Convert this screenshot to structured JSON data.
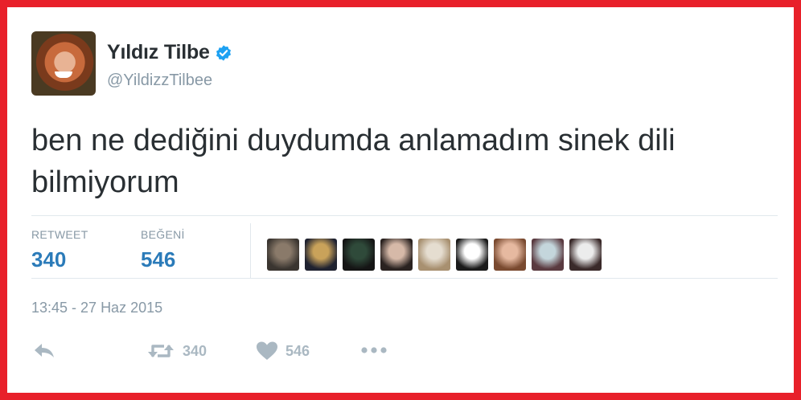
{
  "user": {
    "display_name": "Yıldız Tilbe",
    "handle": "@YildizzTilbee",
    "avatar_icon": "profile-photo",
    "verified_icon": "verified-badge-icon"
  },
  "tweet": {
    "text_line1": "ben ne dediğini duydumda anlamadım sinek dili",
    "text_line2": "bilmiyorum",
    "timestamp": "13:45 - 27 Haz 2015"
  },
  "stats": {
    "retweet_label": "RETWEET",
    "retweet_count": "340",
    "like_label": "BEĞENİ",
    "like_count": "546"
  },
  "likers": [
    {
      "name": "liker-avatar-1",
      "c1": "#8a7a6a",
      "c2": "#3a3530"
    },
    {
      "name": "liker-avatar-2",
      "c1": "#c9a25a",
      "c2": "#1f2230"
    },
    {
      "name": "liker-avatar-3",
      "c1": "#2f4a3a",
      "c2": "#151515"
    },
    {
      "name": "liker-avatar-4",
      "c1": "#d6b9a8",
      "c2": "#2a2220"
    },
    {
      "name": "liker-avatar-5",
      "c1": "#e5ddd0",
      "c2": "#a89070"
    },
    {
      "name": "liker-avatar-6",
      "c1": "#ffffff",
      "c2": "#1a1a1a"
    },
    {
      "name": "liker-avatar-7",
      "c1": "#e6b9a0",
      "c2": "#7a4a30"
    },
    {
      "name": "liker-avatar-8",
      "c1": "#c4d6dc",
      "c2": "#5a3a40"
    },
    {
      "name": "liker-avatar-9",
      "c1": "#ececec",
      "c2": "#3a2a2a"
    }
  ],
  "actions": {
    "reply_icon": "reply-icon",
    "retweet_icon": "retweet-icon",
    "retweet_count": "340",
    "like_icon": "heart-icon",
    "like_count": "546",
    "more_icon": "more-dots-icon"
  },
  "colors": {
    "frame": "#e8202a",
    "link_blue": "#2b7bb9",
    "muted": "#8899a6",
    "verified": "#1da1f2"
  }
}
